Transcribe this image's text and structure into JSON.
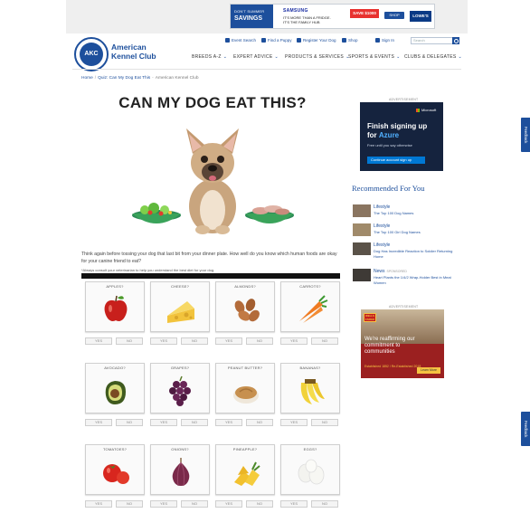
{
  "top_ad": {
    "left_line1": "DON'T SUMMER",
    "left_line2": "SAVINGS",
    "brand": "SAMSUNG",
    "tagline": "IT'S MORE THAN A FRIDGE. IT'S THE FAMILY HUB",
    "save": "SAVE $1000",
    "shop": "SHOP NOW",
    "retailer": "LOWE'S"
  },
  "logo": {
    "initials": "AKC",
    "name": "American Kennel Club"
  },
  "utility_nav": [
    "Event Search",
    "Find a Puppy",
    "Register Your Dog",
    "Shop",
    "Sign In"
  ],
  "search": {
    "placeholder": "Search"
  },
  "main_nav": [
    "BREEDS A-Z",
    "EXPERT ADVICE",
    "PRODUCTS & SERVICES",
    "SPORTS & EVENTS",
    "CLUBS & DELEGATES"
  ],
  "breadcrumb": [
    "Home",
    "Quiz: Can My Dog Eat This",
    "American Kennel Club"
  ],
  "page_title": "CAN MY DOG EAT THIS?",
  "intro": "Think again before tossing your dog that last bit from your dinner plate. How well do you know which human foods are okay for your canine friend to eat?",
  "disclaimer": "*Always consult your veterinarian to help you understand the best diet for your dog.",
  "buttons": {
    "yes": "YES",
    "no": "NO"
  },
  "foods": [
    {
      "label": "APPLES?",
      "icon": "apple-icon"
    },
    {
      "label": "CHEESE?",
      "icon": "cheese-icon"
    },
    {
      "label": "ALMONDS?",
      "icon": "almonds-icon"
    },
    {
      "label": "CARROTS?",
      "icon": "carrots-icon"
    },
    {
      "label": "AVOCADO?",
      "icon": "avocado-icon"
    },
    {
      "label": "GRAPES?",
      "icon": "grapes-icon"
    },
    {
      "label": "PEANUT BUTTER?",
      "icon": "peanut-butter-icon"
    },
    {
      "label": "BANANAS?",
      "icon": "bananas-icon"
    },
    {
      "label": "TOMATOES?",
      "icon": "tomatoes-icon"
    },
    {
      "label": "ONIONS?",
      "icon": "onions-icon"
    },
    {
      "label": "PINEAPPLE?",
      "icon": "pineapple-icon"
    },
    {
      "label": "EGGS?",
      "icon": "eggs-icon"
    }
  ],
  "sidebar": {
    "ad_label": "ADVERTISEMENT",
    "azure_ad": {
      "brand": "Microsoft",
      "headline1": "Finish signing up",
      "headline2_prefix": "for",
      "headline2_accent": "Azure",
      "sub": "Free until you say otherwise",
      "cta": "Continue account sign up"
    },
    "recommended_heading": "Recommended For You",
    "recommended": [
      {
        "category": "Lifestyle",
        "sponsored": "",
        "title": "The Top 100 Dog Names"
      },
      {
        "category": "Lifestyle",
        "sponsored": "",
        "title": "The Top 100 Girl Dog Names"
      },
      {
        "category": "Lifestyle",
        "sponsored": "",
        "title": "Dog Has Incredible Reaction to Soldier Returning Home"
      },
      {
        "category": "News",
        "sponsored": "SPONSORED",
        "title": "Heart Plants the 1/4/2 Wrap-Holder Best in Meat Women"
      }
    ],
    "wf_ad": {
      "logo": "WELLS FARGO",
      "text": "We're reaffirming our commitment to communities",
      "est": "Established 1852 / Re-Established 2018",
      "learn": "Learn More"
    }
  },
  "feedback_label": "Feedback",
  "colors": {
    "brand_blue": "#1d4f9c",
    "card_bg": "#fafafa"
  }
}
